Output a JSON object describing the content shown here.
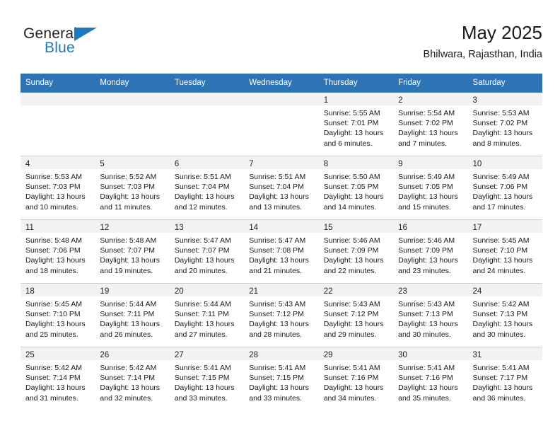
{
  "brand": {
    "name_part1": "General",
    "name_part2": "Blue",
    "color_dark": "#231f20",
    "color_blue": "#1c78c0"
  },
  "header": {
    "title": "May 2025",
    "subtitle": "Bhilwara, Rajasthan, India"
  },
  "theme": {
    "header_bg": "#2e74b5",
    "daynum_band_bg": "#f2f2f2",
    "row_separator": "#cfcfcf",
    "text": "#1a1a1a"
  },
  "weekday_headers": [
    "Sunday",
    "Monday",
    "Tuesday",
    "Wednesday",
    "Thursday",
    "Friday",
    "Saturday"
  ],
  "weeks": [
    [
      {
        "day": "",
        "lines": [
          "",
          "",
          "",
          ""
        ]
      },
      {
        "day": "",
        "lines": [
          "",
          "",
          "",
          ""
        ]
      },
      {
        "day": "",
        "lines": [
          "",
          "",
          "",
          ""
        ]
      },
      {
        "day": "",
        "lines": [
          "",
          "",
          "",
          ""
        ]
      },
      {
        "day": "1",
        "lines": [
          "Sunrise: 5:55 AM",
          "Sunset: 7:01 PM",
          "Daylight: 13 hours",
          "and 6 minutes."
        ]
      },
      {
        "day": "2",
        "lines": [
          "Sunrise: 5:54 AM",
          "Sunset: 7:02 PM",
          "Daylight: 13 hours",
          "and 7 minutes."
        ]
      },
      {
        "day": "3",
        "lines": [
          "Sunrise: 5:53 AM",
          "Sunset: 7:02 PM",
          "Daylight: 13 hours",
          "and 8 minutes."
        ]
      }
    ],
    [
      {
        "day": "4",
        "lines": [
          "Sunrise: 5:53 AM",
          "Sunset: 7:03 PM",
          "Daylight: 13 hours",
          "and 10 minutes."
        ]
      },
      {
        "day": "5",
        "lines": [
          "Sunrise: 5:52 AM",
          "Sunset: 7:03 PM",
          "Daylight: 13 hours",
          "and 11 minutes."
        ]
      },
      {
        "day": "6",
        "lines": [
          "Sunrise: 5:51 AM",
          "Sunset: 7:04 PM",
          "Daylight: 13 hours",
          "and 12 minutes."
        ]
      },
      {
        "day": "7",
        "lines": [
          "Sunrise: 5:51 AM",
          "Sunset: 7:04 PM",
          "Daylight: 13 hours",
          "and 13 minutes."
        ]
      },
      {
        "day": "8",
        "lines": [
          "Sunrise: 5:50 AM",
          "Sunset: 7:05 PM",
          "Daylight: 13 hours",
          "and 14 minutes."
        ]
      },
      {
        "day": "9",
        "lines": [
          "Sunrise: 5:49 AM",
          "Sunset: 7:05 PM",
          "Daylight: 13 hours",
          "and 15 minutes."
        ]
      },
      {
        "day": "10",
        "lines": [
          "Sunrise: 5:49 AM",
          "Sunset: 7:06 PM",
          "Daylight: 13 hours",
          "and 17 minutes."
        ]
      }
    ],
    [
      {
        "day": "11",
        "lines": [
          "Sunrise: 5:48 AM",
          "Sunset: 7:06 PM",
          "Daylight: 13 hours",
          "and 18 minutes."
        ]
      },
      {
        "day": "12",
        "lines": [
          "Sunrise: 5:48 AM",
          "Sunset: 7:07 PM",
          "Daylight: 13 hours",
          "and 19 minutes."
        ]
      },
      {
        "day": "13",
        "lines": [
          "Sunrise: 5:47 AM",
          "Sunset: 7:07 PM",
          "Daylight: 13 hours",
          "and 20 minutes."
        ]
      },
      {
        "day": "14",
        "lines": [
          "Sunrise: 5:47 AM",
          "Sunset: 7:08 PM",
          "Daylight: 13 hours",
          "and 21 minutes."
        ]
      },
      {
        "day": "15",
        "lines": [
          "Sunrise: 5:46 AM",
          "Sunset: 7:09 PM",
          "Daylight: 13 hours",
          "and 22 minutes."
        ]
      },
      {
        "day": "16",
        "lines": [
          "Sunrise: 5:46 AM",
          "Sunset: 7:09 PM",
          "Daylight: 13 hours",
          "and 23 minutes."
        ]
      },
      {
        "day": "17",
        "lines": [
          "Sunrise: 5:45 AM",
          "Sunset: 7:10 PM",
          "Daylight: 13 hours",
          "and 24 minutes."
        ]
      }
    ],
    [
      {
        "day": "18",
        "lines": [
          "Sunrise: 5:45 AM",
          "Sunset: 7:10 PM",
          "Daylight: 13 hours",
          "and 25 minutes."
        ]
      },
      {
        "day": "19",
        "lines": [
          "Sunrise: 5:44 AM",
          "Sunset: 7:11 PM",
          "Daylight: 13 hours",
          "and 26 minutes."
        ]
      },
      {
        "day": "20",
        "lines": [
          "Sunrise: 5:44 AM",
          "Sunset: 7:11 PM",
          "Daylight: 13 hours",
          "and 27 minutes."
        ]
      },
      {
        "day": "21",
        "lines": [
          "Sunrise: 5:43 AM",
          "Sunset: 7:12 PM",
          "Daylight: 13 hours",
          "and 28 minutes."
        ]
      },
      {
        "day": "22",
        "lines": [
          "Sunrise: 5:43 AM",
          "Sunset: 7:12 PM",
          "Daylight: 13 hours",
          "and 29 minutes."
        ]
      },
      {
        "day": "23",
        "lines": [
          "Sunrise: 5:43 AM",
          "Sunset: 7:13 PM",
          "Daylight: 13 hours",
          "and 30 minutes."
        ]
      },
      {
        "day": "24",
        "lines": [
          "Sunrise: 5:42 AM",
          "Sunset: 7:13 PM",
          "Daylight: 13 hours",
          "and 30 minutes."
        ]
      }
    ],
    [
      {
        "day": "25",
        "lines": [
          "Sunrise: 5:42 AM",
          "Sunset: 7:14 PM",
          "Daylight: 13 hours",
          "and 31 minutes."
        ]
      },
      {
        "day": "26",
        "lines": [
          "Sunrise: 5:42 AM",
          "Sunset: 7:14 PM",
          "Daylight: 13 hours",
          "and 32 minutes."
        ]
      },
      {
        "day": "27",
        "lines": [
          "Sunrise: 5:41 AM",
          "Sunset: 7:15 PM",
          "Daylight: 13 hours",
          "and 33 minutes."
        ]
      },
      {
        "day": "28",
        "lines": [
          "Sunrise: 5:41 AM",
          "Sunset: 7:15 PM",
          "Daylight: 13 hours",
          "and 33 minutes."
        ]
      },
      {
        "day": "29",
        "lines": [
          "Sunrise: 5:41 AM",
          "Sunset: 7:16 PM",
          "Daylight: 13 hours",
          "and 34 minutes."
        ]
      },
      {
        "day": "30",
        "lines": [
          "Sunrise: 5:41 AM",
          "Sunset: 7:16 PM",
          "Daylight: 13 hours",
          "and 35 minutes."
        ]
      },
      {
        "day": "31",
        "lines": [
          "Sunrise: 5:41 AM",
          "Sunset: 7:17 PM",
          "Daylight: 13 hours",
          "and 36 minutes."
        ]
      }
    ]
  ]
}
